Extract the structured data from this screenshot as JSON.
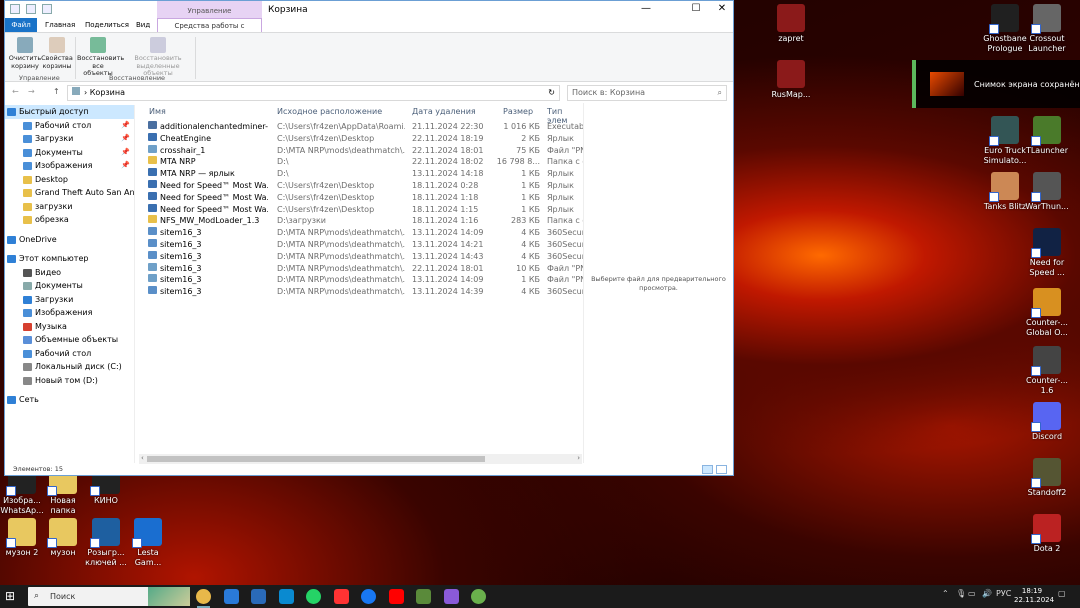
{
  "desktop": {
    "right_icons": [
      {
        "label": "zapret",
        "color": "#8b1a1a"
      },
      {
        "label": "RusMap...",
        "color": "#8b1a1a"
      },
      {
        "label": "Ghostbane Prologue",
        "color": "#202020"
      },
      {
        "label": "Crossout Launcher",
        "color": "#666"
      },
      {
        "label": "Euro Truck Simulato...",
        "color": "#355"
      },
      {
        "label": "TLauncher",
        "color": "#4a7a2a"
      },
      {
        "label": "Tanks Blitz",
        "color": "#c85"
      },
      {
        "label": "WarThun...",
        "color": "#555"
      },
      {
        "label": "Need for Speed ...",
        "color": "#124"
      },
      {
        "label": "Counter-... Global O...",
        "color": "#d89020"
      },
      {
        "label": "Counter-... 1.6",
        "color": "#444"
      },
      {
        "label": "Discord",
        "color": "#5865f2"
      },
      {
        "label": "Standoff2",
        "color": "#553"
      },
      {
        "label": "Dota 2",
        "color": "#b22"
      }
    ],
    "left_icons": [
      {
        "label": "Изобра... WhatsAp...",
        "color": "#222"
      },
      {
        "label": "Новая папка",
        "color": "#e8c860"
      },
      {
        "label": "КИНО",
        "color": "#222"
      },
      {
        "label": "музон 2",
        "color": "#e8c860"
      },
      {
        "label": "музон",
        "color": "#e8c860"
      },
      {
        "label": "Розыгр... ключей ...",
        "color": "#1e5fa0"
      },
      {
        "label": "Lesta Gam...",
        "color": "#1a6ed0"
      }
    ],
    "snap_text": "Снимок экрана сохранён"
  },
  "window": {
    "title": "Корзина",
    "context_header": "Управление",
    "controls": {
      "min": "—",
      "max": "☐",
      "close": "✕"
    },
    "tabs": [
      "Файл",
      "Главная",
      "Поделиться",
      "Вид"
    ],
    "context_tab": "Средства работы с корзиной",
    "ribbon": {
      "buttons": [
        "Очистить корзину",
        "Свойства корзины",
        "Восстановить все объекты",
        "Восстановить выделенные объекты"
      ],
      "groups": [
        "Управление",
        "Восстановление"
      ]
    },
    "address": {
      "path": "Корзина",
      "search_placeholder": "Поиск в: Корзина",
      "back": "←",
      "forward": "→",
      "up": "↑",
      "refresh": "↻"
    },
    "nav": {
      "quick_access": "Быстрый доступ",
      "quick_items": [
        {
          "label": "Рабочий стол",
          "pin": "📌"
        },
        {
          "label": "Загрузки",
          "pin": "📌"
        },
        {
          "label": "Документы",
          "pin": "📌"
        },
        {
          "label": "Изображения",
          "pin": "📌"
        },
        {
          "label": "Desktop",
          "pin": ""
        },
        {
          "label": "Grand Theft Auto San Andreas",
          "pin": ""
        },
        {
          "label": "загрузки",
          "pin": ""
        },
        {
          "label": "обрезка",
          "pin": ""
        }
      ],
      "onedrive": "OneDrive",
      "this_pc": "Этот компьютер",
      "pc_items": [
        "Видео",
        "Документы",
        "Загрузки",
        "Изображения",
        "Музыка",
        "Объемные объекты",
        "Рабочий стол",
        "Локальный диск (C:)",
        "Новый том (D:)"
      ],
      "network": "Сеть"
    },
    "columns": [
      "Имя",
      "Исходное расположение",
      "Дата удаления",
      "Размер",
      "Тип элем"
    ],
    "files": [
      {
        "name": "additionalenchantedminer-...",
        "loc": "C:\\Users\\fr4zen\\AppData\\Roami...",
        "date": "21.11.2024 22:30",
        "size": "1 016 КБ",
        "type": "Executabl"
      },
      {
        "name": "CheatEngine",
        "loc": "C:\\Users\\fr4zen\\Desktop",
        "date": "22.11.2024 18:19",
        "size": "2 КБ",
        "type": "Ярлык"
      },
      {
        "name": "crosshair_1",
        "loc": "D:\\MTA NRP\\mods\\deathmatch\\...",
        "date": "22.11.2024 18:01",
        "size": "75 КБ",
        "type": "Файл \"PN"
      },
      {
        "name": "MTA NRP",
        "loc": "D:\\",
        "date": "22.11.2024 18:02",
        "size": "16 798 8...",
        "type": "Папка с ф"
      },
      {
        "name": "MTA NRP — ярлык",
        "loc": "D:\\",
        "date": "13.11.2024 14:18",
        "size": "1 КБ",
        "type": "Ярлык"
      },
      {
        "name": "Need for Speed™ Most Wa...",
        "loc": "C:\\Users\\fr4zen\\Desktop",
        "date": "18.11.2024 0:28",
        "size": "1 КБ",
        "type": "Ярлык"
      },
      {
        "name": "Need for Speed™ Most Wa...",
        "loc": "C:\\Users\\fr4zen\\Desktop",
        "date": "18.11.2024 1:18",
        "size": "1 КБ",
        "type": "Ярлык"
      },
      {
        "name": "Need for Speed™ Most Wa...",
        "loc": "C:\\Users\\fr4zen\\Desktop",
        "date": "18.11.2024 1:15",
        "size": "1 КБ",
        "type": "Ярлык"
      },
      {
        "name": "NFS_MW_ModLoader_1.3",
        "loc": "D:\\загрузки",
        "date": "18.11.2024 1:16",
        "size": "283 КБ",
        "type": "Папка с ф"
      },
      {
        "name": "sitem16_3",
        "loc": "D:\\MTA NRP\\mods\\deathmatch\\...",
        "date": "13.11.2024 14:09",
        "size": "4 КБ",
        "type": "360Secure"
      },
      {
        "name": "sitem16_3",
        "loc": "D:\\MTA NRP\\mods\\deathmatch\\...",
        "date": "13.11.2024 14:21",
        "size": "4 КБ",
        "type": "360Secure"
      },
      {
        "name": "sitem16_3",
        "loc": "D:\\MTA NRP\\mods\\deathmatch\\...",
        "date": "13.11.2024 14:43",
        "size": "4 КБ",
        "type": "360Secure"
      },
      {
        "name": "sitem16_3",
        "loc": "D:\\MTA NRP\\mods\\deathmatch\\...",
        "date": "22.11.2024 18:01",
        "size": "10 КБ",
        "type": "Файл \"PN"
      },
      {
        "name": "sitem16_3",
        "loc": "D:\\MTA NRP\\mods\\deathmatch\\...",
        "date": "13.11.2024 14:09",
        "size": "1 КБ",
        "type": "Файл \"PN"
      },
      {
        "name": "sitem16_3",
        "loc": "D:\\MTA NRP\\mods\\deathmatch\\...",
        "date": "13.11.2024 14:39",
        "size": "4 КБ",
        "type": "360Secure"
      }
    ],
    "preview_text": "Выберите файл для предварительного просмотра.",
    "status": "Элементов: 15"
  },
  "taskbar": {
    "search_placeholder": "Поиск",
    "lang": "РУС",
    "time": "18:19",
    "date": "22.11.2024",
    "apps": [
      "file-explorer",
      "store",
      "mail",
      "edge",
      "whatsapp",
      "yandex",
      "facebook",
      "youtube",
      "minecraft",
      "steam-chat",
      "utorrent"
    ]
  }
}
